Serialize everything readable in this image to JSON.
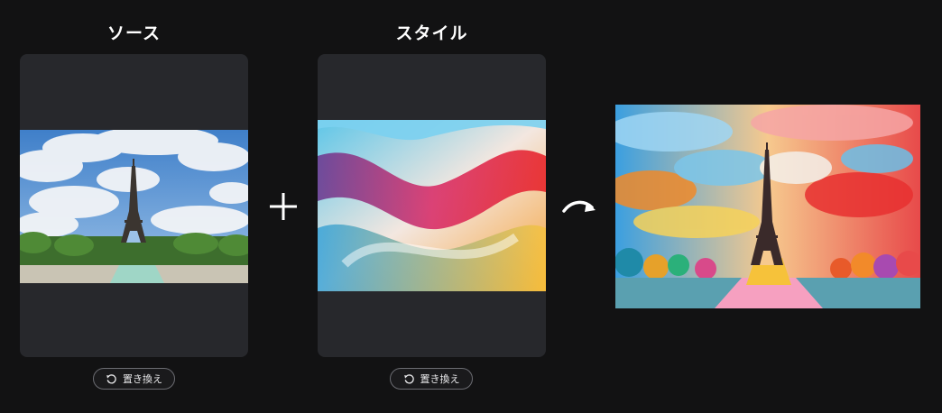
{
  "source": {
    "title": "ソース",
    "replace_label": "置き換え",
    "image_icon": "eiffel-tower-photo"
  },
  "style": {
    "title": "スタイル",
    "replace_label": "置き換え",
    "image_icon": "abstract-fluid-swirl"
  },
  "operators": {
    "plus_icon": "plus-icon",
    "arrow_icon": "curved-arrow-right-icon"
  },
  "result": {
    "image_icon": "stylized-eiffel-tower"
  },
  "colors": {
    "background": "#121213",
    "panel": "#27282c",
    "button_border": "#6b6c72"
  }
}
